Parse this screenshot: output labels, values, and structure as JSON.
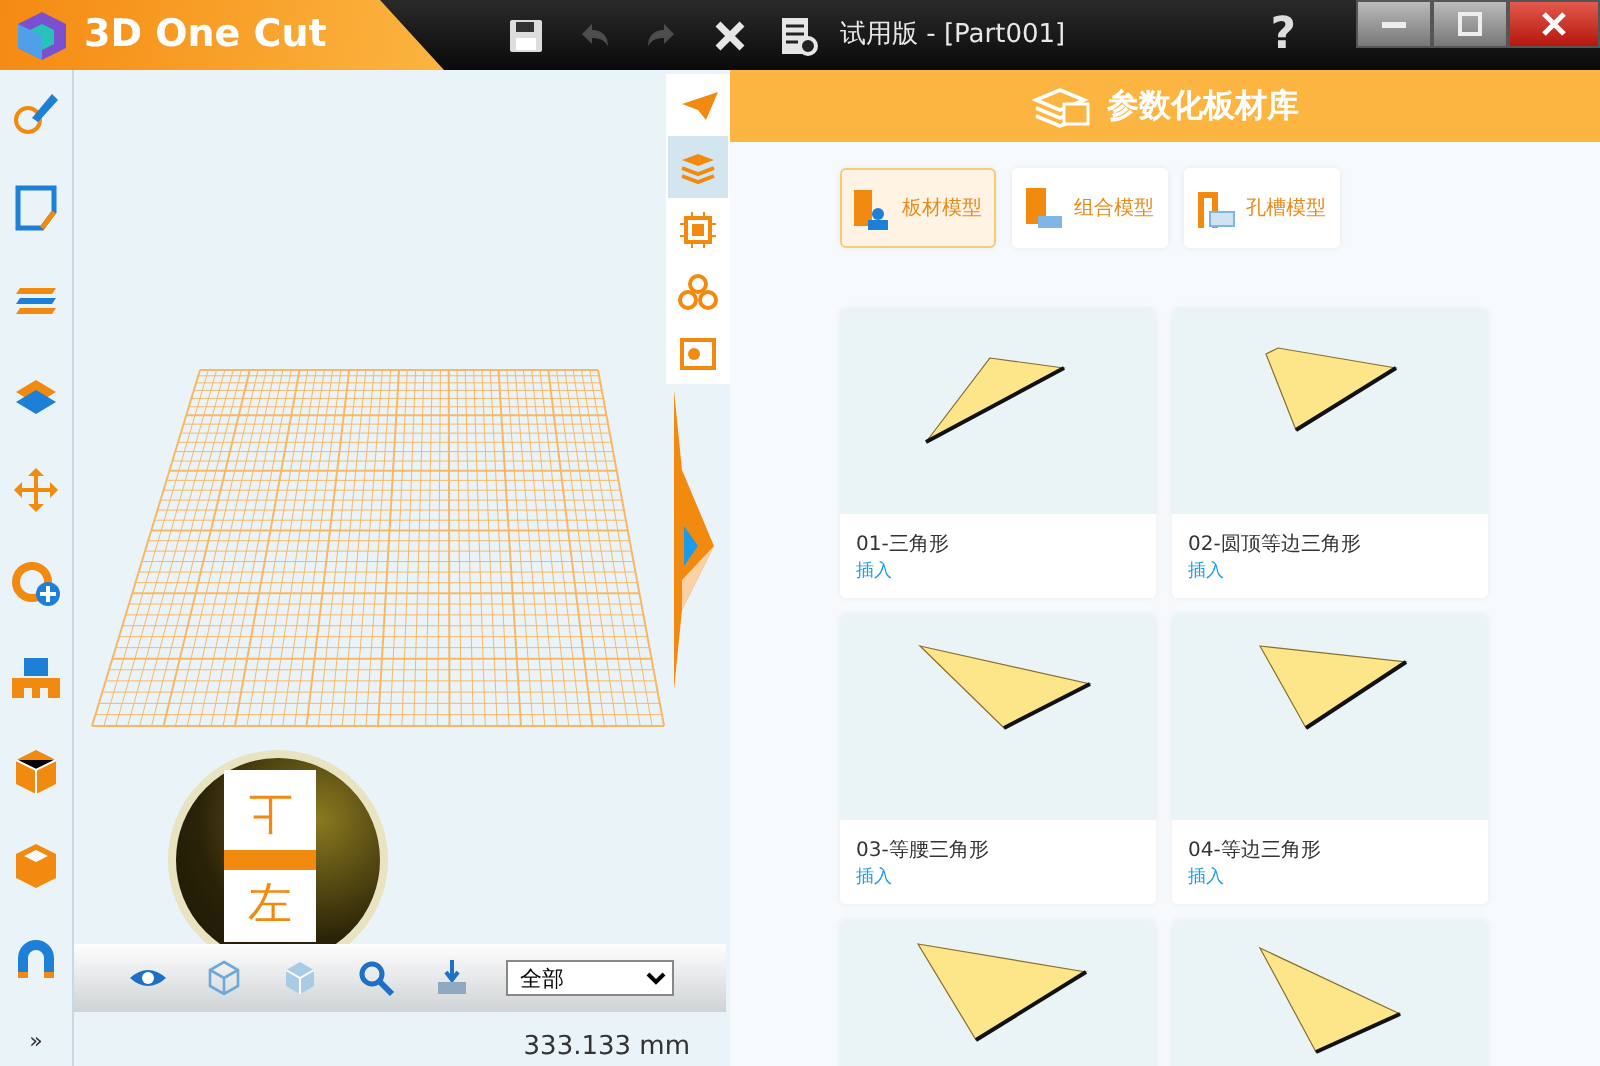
{
  "title_bar": {
    "app_name": "3D One Cut",
    "document_title": "试用版 - [Part001]",
    "help": "?",
    "toolbar": [
      {
        "kind": "save",
        "disabled": false
      },
      {
        "kind": "undo",
        "disabled": true
      },
      {
        "kind": "redo",
        "disabled": true
      },
      {
        "kind": "close",
        "disabled": false
      },
      {
        "kind": "settings",
        "disabled": false
      }
    ]
  },
  "left_toolbar": {
    "expand_label": "»"
  },
  "viewport": {
    "side_strip": [
      {
        "kind": "plane",
        "selected": false
      },
      {
        "kind": "boards",
        "selected": true
      },
      {
        "kind": "chip",
        "selected": false
      },
      {
        "kind": "cluster",
        "selected": false
      },
      {
        "kind": "image",
        "selected": false
      }
    ],
    "view_cube": {
      "top_face": "上",
      "front_face": "左"
    },
    "bottom_toolbar": [
      {
        "kind": "eye"
      },
      {
        "kind": "cube"
      },
      {
        "kind": "cube-shaded"
      },
      {
        "kind": "zoom"
      },
      {
        "kind": "import"
      }
    ],
    "filter_select": {
      "value": "全部"
    },
    "status": "333.133 mm"
  },
  "library": {
    "title": "参数化板材库",
    "tabs": [
      {
        "label": "板材模型",
        "selected": true
      },
      {
        "label": "组合模型",
        "selected": false
      },
      {
        "label": "孔槽模型",
        "selected": false
      }
    ],
    "items": [
      {
        "kind": "full",
        "name": "01-三角形",
        "action": "插入"
      },
      {
        "kind": "full",
        "name": "02-圆顶等边三角形",
        "action": "插入"
      },
      {
        "kind": "full",
        "name": "03-等腰三角形",
        "action": "插入"
      },
      {
        "kind": "full",
        "name": "04-等边三角形",
        "action": "插入"
      },
      {
        "kind": "cut-off"
      },
      {
        "kind": "cut-off"
      }
    ]
  }
}
